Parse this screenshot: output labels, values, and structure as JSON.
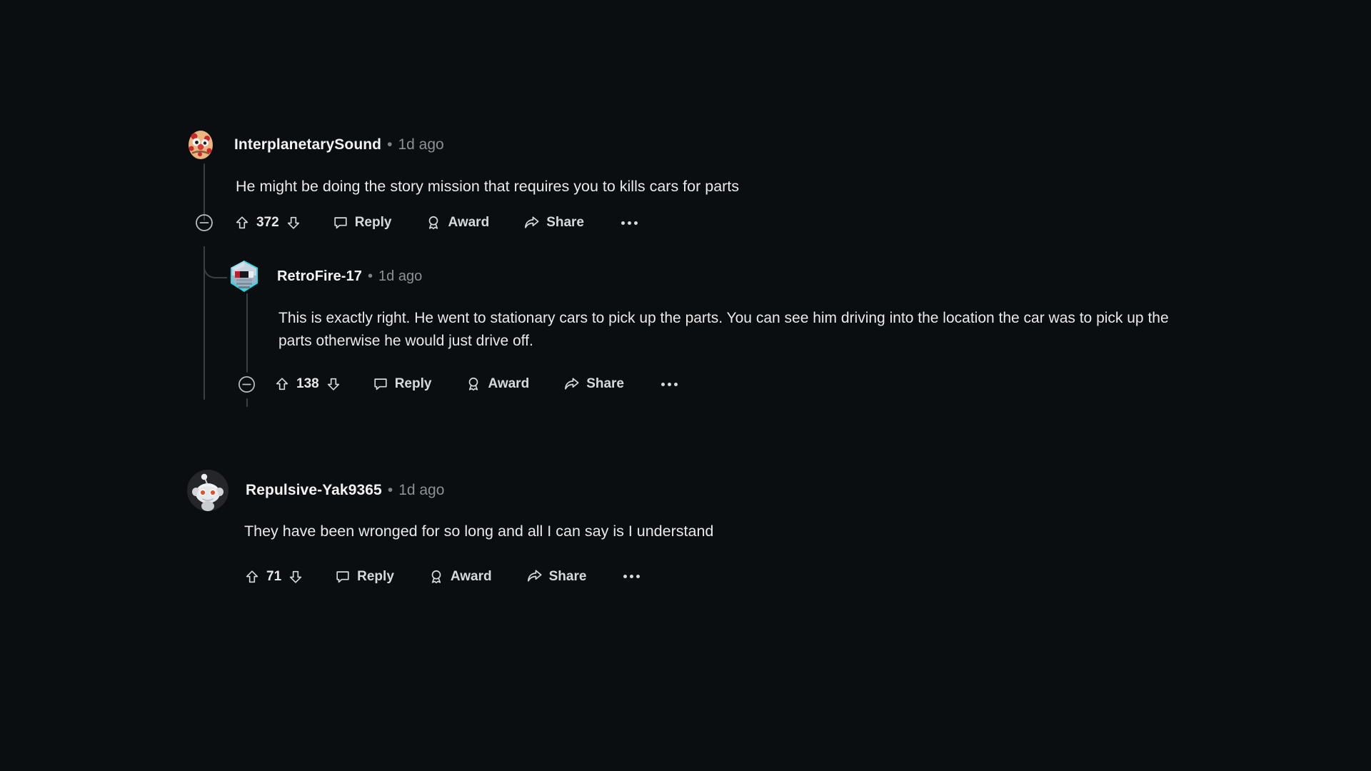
{
  "theme": {
    "background": "#0b0e11",
    "text_primary": "#e9eaec",
    "text_muted": "#8b9197",
    "thread_line": "#3a3f45",
    "icon": "#d7dadc"
  },
  "comments": [
    {
      "id": "comment-interplanetarysound",
      "depth": 0,
      "author": "InterplanetarySound",
      "separator": "•",
      "timestamp": "1d ago",
      "avatar": "pizza-face-avatar",
      "body": "He might be doing the story mission that requires you to kills cars for parts",
      "collapse_icon": "collapse-minus-icon",
      "has_collapse": true,
      "votes": "372",
      "upvote_icon": "upvote-arrow-icon",
      "downvote_icon": "downvote-arrow-icon",
      "reply_label": "Reply",
      "reply_icon": "comment-bubble-icon",
      "award_label": "Award",
      "award_icon": "award-medal-icon",
      "share_label": "Share",
      "share_icon": "share-arrow-icon",
      "more_icon": "more-options-icon"
    },
    {
      "id": "comment-retrofire-17",
      "depth": 1,
      "author": "RetroFire-17",
      "separator": "•",
      "timestamp": "1d ago",
      "avatar": "robot-shield-avatar",
      "body": "This is exactly right. He went to stationary cars to pick up the parts. You can see him driving into the location the car was to pick up the parts otherwise he would just drive off.",
      "collapse_icon": "collapse-minus-icon",
      "has_collapse": true,
      "votes": "138",
      "upvote_icon": "upvote-arrow-icon",
      "downvote_icon": "downvote-arrow-icon",
      "reply_label": "Reply",
      "reply_icon": "comment-bubble-icon",
      "award_label": "Award",
      "award_icon": "award-medal-icon",
      "share_label": "Share",
      "share_icon": "share-arrow-icon",
      "more_icon": "more-options-icon"
    },
    {
      "id": "comment-repulsive-yak9365",
      "depth": 0,
      "author": "Repulsive-Yak9365",
      "separator": "•",
      "timestamp": "1d ago",
      "avatar": "snoo-grey-avatar",
      "body": "They have been wronged for so long and all I can say is I understand",
      "collapse_icon": "collapse-minus-icon",
      "has_collapse": false,
      "votes": "71",
      "upvote_icon": "upvote-arrow-icon",
      "downvote_icon": "downvote-arrow-icon",
      "reply_label": "Reply",
      "reply_icon": "comment-bubble-icon",
      "award_label": "Award",
      "award_icon": "award-medal-icon",
      "share_label": "Share",
      "share_icon": "share-arrow-icon",
      "more_icon": "more-options-icon"
    }
  ]
}
